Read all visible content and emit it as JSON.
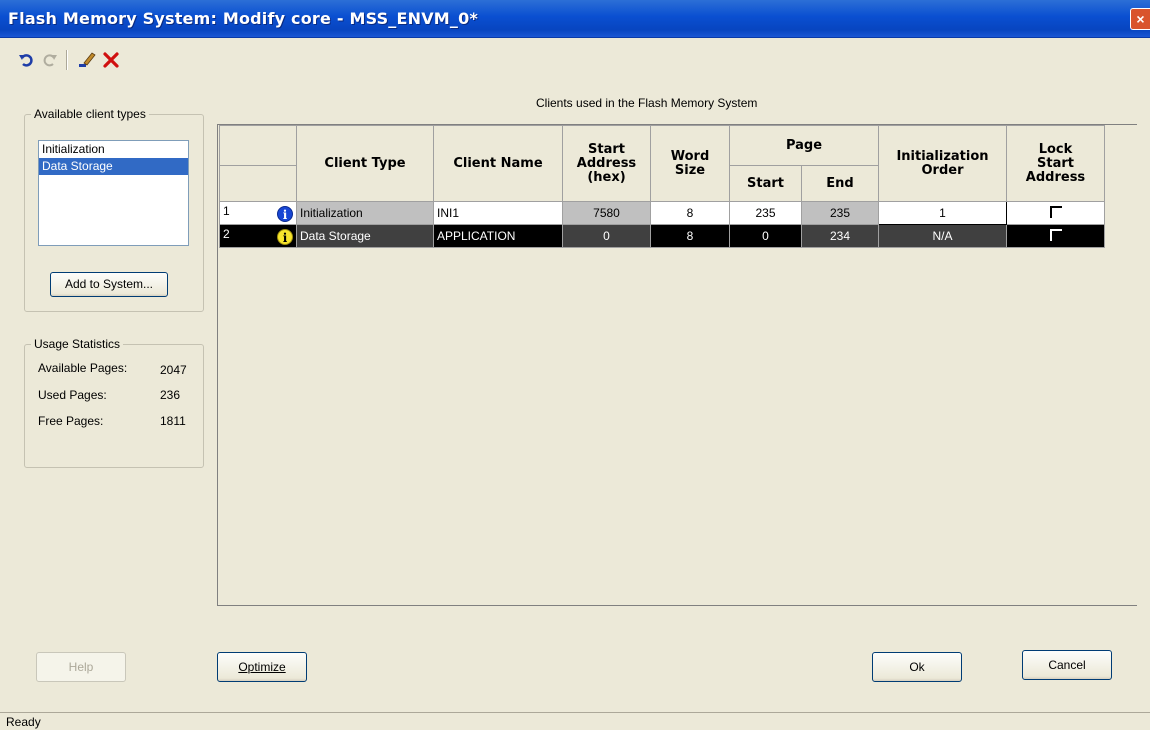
{
  "window": {
    "title": "Flash Memory System: Modify core - MSS_ENVM_0*",
    "close_label": "×"
  },
  "toolbar": {
    "items": [
      "undo-icon",
      "redo-icon",
      "edit-icon",
      "delete-icon"
    ]
  },
  "client_types": {
    "label": "Available client types",
    "items": [
      "Initialization",
      "Data Storage"
    ],
    "selected": "Data Storage",
    "add_button": "Add to System..."
  },
  "usage": {
    "label": "Usage Statistics",
    "rows": [
      {
        "key": "Available Pages:",
        "value": "2047"
      },
      {
        "key": "Used Pages:",
        "value": "236"
      },
      {
        "key": "Free Pages:",
        "value": "1811"
      }
    ]
  },
  "clients": {
    "caption": "Clients used in the Flash Memory System",
    "headers": {
      "client_type": "Client Type",
      "client_name": "Client Name",
      "start_address": "Start Address (hex)",
      "word_size": "Word Size",
      "page": "Page",
      "page_start": "Start",
      "page_end": "End",
      "init_order": "Initialization Order",
      "lock_start": "Lock Start Address"
    },
    "rows": [
      {
        "num": "1",
        "icon": "info-icon",
        "type": "Initialization",
        "name": "INI1",
        "address": "7580",
        "word": "8",
        "start": "235",
        "end": "235",
        "order": "1",
        "lock": false
      },
      {
        "num": "2",
        "icon": "info-icon",
        "type": "Data Storage",
        "name": "APPLICATION",
        "address": "0",
        "word": "8",
        "start": "0",
        "end": "234",
        "order": "N/A",
        "lock": false
      }
    ]
  },
  "buttons": {
    "help": "Help",
    "optimize": "Optimize",
    "ok": "Ok",
    "cancel": "Cancel"
  },
  "status": {
    "text": "Ready"
  },
  "colors": {
    "titlebar": "#0a4fd1",
    "selection": "#316ac5",
    "info_blue": "#1846d4",
    "info_yellow": "#f7e52c"
  }
}
